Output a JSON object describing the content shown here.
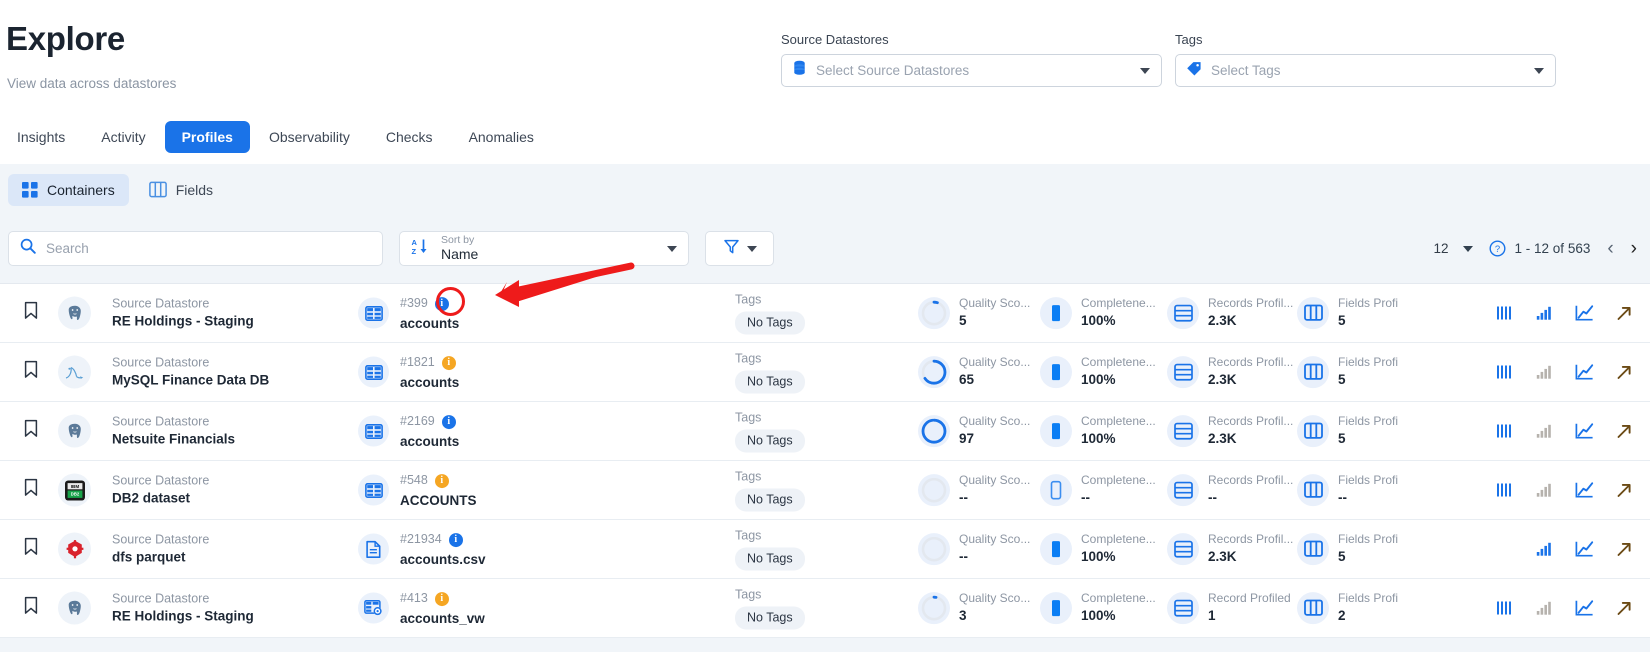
{
  "header": {
    "title": "Explore",
    "subtitle": "View data across datastores",
    "filters": [
      {
        "label": "Source Datastores",
        "placeholder": "Select Source Datastores",
        "icon": "database-icon"
      },
      {
        "label": "Tags",
        "placeholder": "Select Tags",
        "icon": "tag-icon"
      }
    ]
  },
  "tabs": [
    {
      "label": "Insights",
      "active": false
    },
    {
      "label": "Activity",
      "active": false
    },
    {
      "label": "Profiles",
      "active": true
    },
    {
      "label": "Observability",
      "active": false
    },
    {
      "label": "Checks",
      "active": false
    },
    {
      "label": "Anomalies",
      "active": false
    }
  ],
  "segments": [
    {
      "label": "Containers",
      "icon": "grid-icon",
      "active": true
    },
    {
      "label": "Fields",
      "icon": "columns-icon",
      "active": false
    }
  ],
  "toolbar": {
    "search_placeholder": "Search",
    "search_value": "",
    "search_icon": "search-icon",
    "sort_caption": "Sort by",
    "sort_value": "Name",
    "sort_icon": "sort-az-icon",
    "filter_icon": "funnel-icon"
  },
  "pagination": {
    "page_size": "12",
    "range": "1 - 12 of 563",
    "help_icon": "help-circle-icon",
    "prev": "‹",
    "next": "›"
  },
  "columns": {
    "datastore_caption": "Source Datastore",
    "tags_caption": "Tags",
    "quality_caption": "Quality Sco...",
    "completeness_caption": "Completene...",
    "records_caption": "Records Profil...",
    "fields_caption": "Fields Profi"
  },
  "colors": {
    "accent": "#1a73e8",
    "panel_bg": "#f1f5f9",
    "badge_bg": "#e9f0fb",
    "muted": "#8d96a3",
    "amber": "#f5a623",
    "annotation": "#ee1b1b"
  },
  "rows": [
    {
      "datastore_caption": "Source Datastore",
      "datastore_name": "RE Holdings - Staging",
      "datastore_icon": "postgresql-icon",
      "container_icon": "table-icon",
      "container_id": "#399",
      "container_name": "accounts",
      "info_severity": "blue",
      "tags_caption": "Tags",
      "tags_value": "No Tags",
      "quality_caption": "Quality Sco...",
      "quality_value": "5",
      "quality_pct": 5,
      "completeness_caption": "Completene...",
      "completeness_value": "100%",
      "completeness_pct": 100,
      "records_caption": "Records Profil...",
      "records_value": "2.3K",
      "fields_caption": "Fields Profi",
      "fields_value": "5",
      "actions": [
        "bars-icon",
        "bar-chart-icon",
        "line-chart-icon",
        "external-link-icon"
      ],
      "disabled_actions": [],
      "annotated": true
    },
    {
      "datastore_caption": "Source Datastore",
      "datastore_name": "MySQL Finance Data DB",
      "datastore_icon": "mysql-icon",
      "container_icon": "table-icon",
      "container_id": "#1821",
      "container_name": "accounts",
      "info_severity": "amber",
      "tags_caption": "Tags",
      "tags_value": "No Tags",
      "quality_caption": "Quality Sco...",
      "quality_value": "65",
      "quality_pct": 65,
      "completeness_caption": "Completene...",
      "completeness_value": "100%",
      "completeness_pct": 100,
      "records_caption": "Records Profil...",
      "records_value": "2.3K",
      "fields_caption": "Fields Profi",
      "fields_value": "5",
      "actions": [
        "bars-icon",
        "bar-chart-icon",
        "line-chart-icon",
        "external-link-icon"
      ],
      "disabled_actions": [
        "bar-chart-icon"
      ],
      "annotated": false
    },
    {
      "datastore_caption": "Source Datastore",
      "datastore_name": "Netsuite Financials",
      "datastore_icon": "postgresql-icon",
      "container_icon": "table-icon",
      "container_id": "#2169",
      "container_name": "accounts",
      "info_severity": "blue",
      "tags_caption": "Tags",
      "tags_value": "No Tags",
      "quality_caption": "Quality Sco...",
      "quality_value": "97",
      "quality_pct": 97,
      "completeness_caption": "Completene...",
      "completeness_value": "100%",
      "completeness_pct": 100,
      "records_caption": "Records Profil...",
      "records_value": "2.3K",
      "fields_caption": "Fields Profi",
      "fields_value": "5",
      "actions": [
        "bars-icon",
        "bar-chart-icon",
        "line-chart-icon",
        "external-link-icon"
      ],
      "disabled_actions": [
        "bar-chart-icon"
      ],
      "annotated": false
    },
    {
      "datastore_caption": "Source Datastore",
      "datastore_name": "DB2 dataset",
      "datastore_icon": "db2-icon",
      "container_icon": "table-icon",
      "container_id": "#548",
      "container_name": "ACCOUNTS",
      "info_severity": "amber",
      "tags_caption": "Tags",
      "tags_value": "No Tags",
      "quality_caption": "Quality Sco...",
      "quality_value": "--",
      "quality_pct": 0,
      "completeness_caption": "Completene...",
      "completeness_value": "--",
      "completeness_pct": 0,
      "records_caption": "Records Profil...",
      "records_value": "--",
      "fields_caption": "Fields Profi",
      "fields_value": "--",
      "actions": [
        "bars-icon",
        "bar-chart-icon",
        "line-chart-icon",
        "external-link-icon"
      ],
      "disabled_actions": [
        "bar-chart-icon"
      ],
      "annotated": false
    },
    {
      "datastore_caption": "Source Datastore",
      "datastore_name": "dfs parquet",
      "datastore_icon": "drill-icon",
      "container_icon": "file-icon",
      "container_id": "#21934",
      "container_name": "accounts.csv",
      "info_severity": "blue",
      "tags_caption": "Tags",
      "tags_value": "No Tags",
      "quality_caption": "Quality Sco...",
      "quality_value": "--",
      "quality_pct": 0,
      "completeness_caption": "Completene...",
      "completeness_value": "100%",
      "completeness_pct": 100,
      "records_caption": "Records Profil...",
      "records_value": "2.3K",
      "fields_caption": "Fields Profi",
      "fields_value": "5",
      "actions": [
        "bar-chart-icon",
        "line-chart-icon",
        "external-link-icon"
      ],
      "disabled_actions": [],
      "annotated": false
    },
    {
      "datastore_caption": "Source Datastore",
      "datastore_name": "RE Holdings - Staging",
      "datastore_icon": "postgresql-icon",
      "container_icon": "view-icon",
      "container_id": "#413",
      "container_name": "accounts_vw",
      "info_severity": "amber",
      "tags_caption": "Tags",
      "tags_value": "No Tags",
      "quality_caption": "Quality Sco...",
      "quality_value": "3",
      "quality_pct": 3,
      "completeness_caption": "Completene...",
      "completeness_value": "100%",
      "completeness_pct": 100,
      "records_caption": "Record Profiled",
      "records_value": "1",
      "fields_caption": "Fields Profi",
      "fields_value": "2",
      "actions": [
        "bars-icon",
        "bar-chart-icon",
        "line-chart-icon",
        "external-link-icon"
      ],
      "disabled_actions": [
        "bar-chart-icon"
      ],
      "annotated": false
    }
  ]
}
